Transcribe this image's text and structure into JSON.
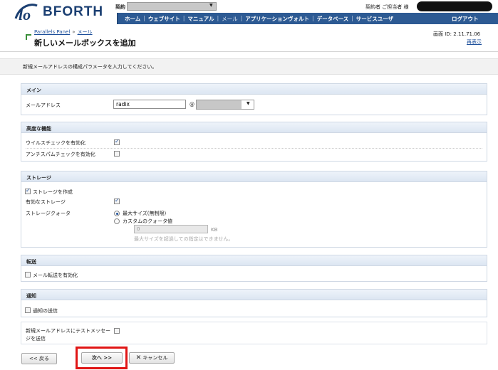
{
  "header": {
    "logo_text": "BFORTH",
    "contract_label": "契約",
    "user_label": "契約者 ご担当者 様",
    "nav_items": [
      "ホーム",
      "ウェブサイト",
      "マニュアル",
      "メール",
      "アプリケーションヴォルト",
      "データベース",
      "サービスユーザ"
    ],
    "logout_label": "ログアウト"
  },
  "title_area": {
    "breadcrumb": [
      "Parallels Panel",
      "メール"
    ],
    "breadcrumb_sep": "»",
    "page_title": "新しいメールボックスを追加",
    "screen_id": "画面 ID: 2.11.71.06",
    "refresh_label": "再表示"
  },
  "intro_text": "新規メールアドレスの構成パラメータを入力してください。",
  "main": {
    "heading": "メイン",
    "email_label": "メールアドレス",
    "email_value": "radix",
    "at_sign": "@"
  },
  "advanced": {
    "heading": "高度な機能",
    "virus_label": "ウイルスチェックを有効化",
    "virus_checked": true,
    "antispam_label": "アンチスパムチェックを有効化",
    "antispam_checked": false
  },
  "storage": {
    "heading": "ストレージ",
    "create_label": "ストレージを作成",
    "create_checked": true,
    "enabled_label": "有効なストレージ",
    "enabled_checked": true,
    "quota_label": "ストレージクォータ",
    "quota_max_label": "最大サイズ(無制限)",
    "quota_custom_label": "カスタムのクォータ値",
    "quota_value": "0",
    "quota_unit": "KB",
    "quota_hint": "最大サイズを超過しての指定はできません。"
  },
  "forwarding": {
    "heading": "転送",
    "enable_label": "メール転送を有効化"
  },
  "notification": {
    "heading": "通知",
    "send_label": "通知の送信"
  },
  "test_message": {
    "label_line1": "新規メールアドレスにテストメッセー",
    "label_line2": "ジを送信"
  },
  "buttons": {
    "back": "<< 戻る",
    "next": "次へ >>",
    "cancel": "キャンセル"
  },
  "colors": {
    "nav_bg": "#2d5a93",
    "link": "#1d4f9b",
    "highlight": "#e01515"
  }
}
